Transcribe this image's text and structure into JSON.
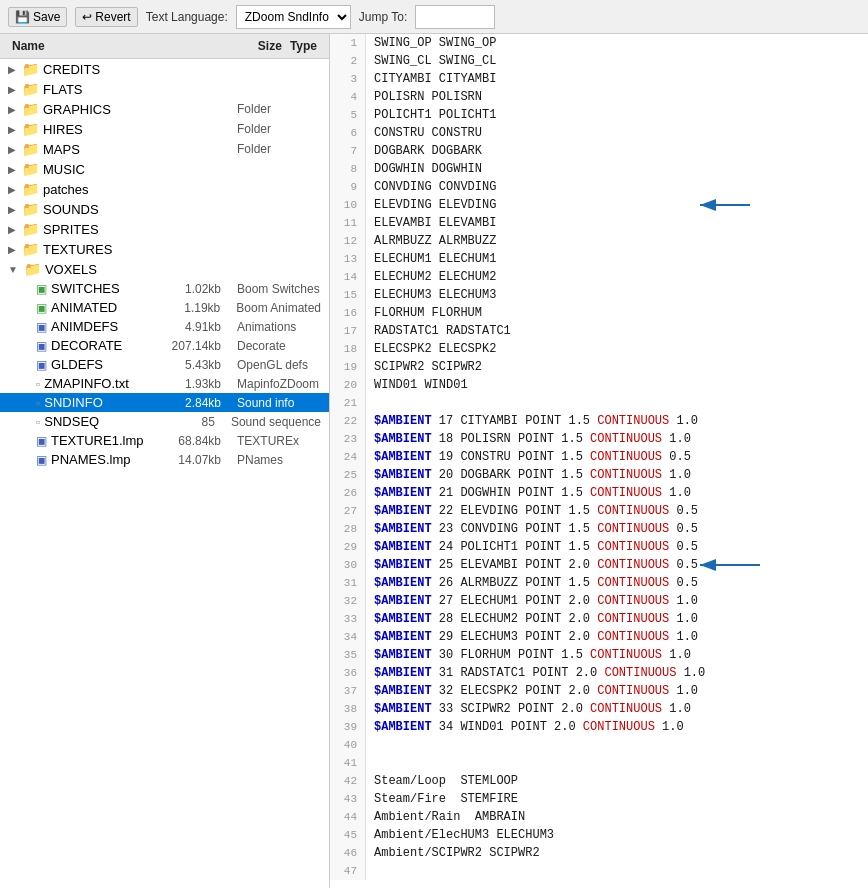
{
  "toolbar": {
    "save_label": "Save",
    "revert_label": "Revert",
    "text_language_label": "Text Language:",
    "text_language_value": "ZDoom SndInfo",
    "jump_to_label": "Jump To:",
    "jump_to_value": ""
  },
  "file_tree": {
    "headers": [
      "Name",
      "Size",
      "Type"
    ],
    "items": [
      {
        "id": "credits",
        "name": "CREDITS",
        "size": "",
        "type": "",
        "indent": 1,
        "icon": "folder",
        "expanded": false
      },
      {
        "id": "flats",
        "name": "FLATS",
        "size": "",
        "type": "",
        "indent": 1,
        "icon": "folder",
        "expanded": false
      },
      {
        "id": "graphics",
        "name": "GRAPHICS",
        "size": "",
        "type": "Folder",
        "indent": 1,
        "icon": "folder",
        "expanded": false
      },
      {
        "id": "hires",
        "name": "HIRES",
        "size": "",
        "type": "Folder",
        "indent": 1,
        "icon": "folder",
        "expanded": false
      },
      {
        "id": "maps",
        "name": "MAPS",
        "size": "",
        "type": "Folder",
        "indent": 1,
        "icon": "folder",
        "expanded": false
      },
      {
        "id": "music",
        "name": "MUSIC",
        "size": "",
        "type": "",
        "indent": 1,
        "icon": "folder",
        "expanded": false
      },
      {
        "id": "patches",
        "name": "patches",
        "size": "",
        "type": "",
        "indent": 1,
        "icon": "folder",
        "expanded": false
      },
      {
        "id": "sounds",
        "name": "SOUNDS",
        "size": "",
        "type": "",
        "indent": 1,
        "icon": "folder",
        "expanded": false
      },
      {
        "id": "sprites",
        "name": "SPRITES",
        "size": "",
        "type": "",
        "indent": 1,
        "icon": "folder",
        "expanded": false
      },
      {
        "id": "textures",
        "name": "TEXTURES",
        "size": "",
        "type": "",
        "indent": 1,
        "icon": "folder",
        "expanded": false
      },
      {
        "id": "voxels",
        "name": "VOXELS",
        "size": "",
        "type": "",
        "indent": 1,
        "icon": "folder",
        "expanded": true
      },
      {
        "id": "switches",
        "name": "SWITCHES",
        "size": "1.02kb",
        "type": "Boom Switches",
        "indent": 2,
        "icon": "file-green"
      },
      {
        "id": "animated",
        "name": "ANIMATED",
        "size": "1.19kb",
        "type": "Boom Animated",
        "indent": 2,
        "icon": "file-green"
      },
      {
        "id": "animdefs",
        "name": "ANIMDEFS",
        "size": "4.91kb",
        "type": "Animations",
        "indent": 2,
        "icon": "file-blue"
      },
      {
        "id": "decorate",
        "name": "DECORATE",
        "size": "207.14kb",
        "type": "Decorate",
        "indent": 2,
        "icon": "file-blue"
      },
      {
        "id": "gldefs",
        "name": "GLDEFS",
        "size": "5.43kb",
        "type": "OpenGL defs",
        "indent": 2,
        "icon": "file-blue"
      },
      {
        "id": "zmapinfo",
        "name": "ZMAPINFO.txt",
        "size": "1.93kb",
        "type": "MapinfoZDoom",
        "indent": 2,
        "icon": "file"
      },
      {
        "id": "sndinfo",
        "name": "SNDINFO",
        "size": "2.84kb",
        "type": "Sound info",
        "indent": 2,
        "icon": "file",
        "selected": true
      },
      {
        "id": "sndseq",
        "name": "SNDSEQ",
        "size": "85",
        "type": "Sound sequence",
        "indent": 2,
        "icon": "file"
      },
      {
        "id": "texture1",
        "name": "TEXTURE1.lmp",
        "size": "68.84kb",
        "type": "TEXTUREx",
        "indent": 2,
        "icon": "file-blue"
      },
      {
        "id": "pnames",
        "name": "PNAMES.lmp",
        "size": "14.07kb",
        "type": "PNames",
        "indent": 2,
        "icon": "file-blue"
      }
    ]
  },
  "code_lines": [
    {
      "num": 1,
      "text": "SWING_OP SWING_OP"
    },
    {
      "num": 2,
      "text": "SWING_CL SWING_CL"
    },
    {
      "num": 3,
      "text": "CITYAMBI CITYAMBI"
    },
    {
      "num": 4,
      "text": "POLISRN POLISRN"
    },
    {
      "num": 5,
      "text": "POLICHT1 POLICHT1"
    },
    {
      "num": 6,
      "text": "CONSTRU CONSTRU"
    },
    {
      "num": 7,
      "text": "DOGBARK DOGBARK"
    },
    {
      "num": 8,
      "text": "DOGWHIN DOGWHIN"
    },
    {
      "num": 9,
      "text": "CONVDING CONVDING"
    },
    {
      "num": 10,
      "text": "ELEVDING ELEVDING"
    },
    {
      "num": 11,
      "text": "ELEVAMBI ELEVAMBI"
    },
    {
      "num": 12,
      "text": "ALRMBUZZ ALRMBUZZ"
    },
    {
      "num": 13,
      "text": "ELECHUM1 ELECHUM1"
    },
    {
      "num": 14,
      "text": "ELECHUM2 ELECHUM2"
    },
    {
      "num": 15,
      "text": "ELECHUM3 ELECHUM3"
    },
    {
      "num": 16,
      "text": "FLORHUM FLORHUM"
    },
    {
      "num": 17,
      "text": "RADSTATC1 RADSTATC1"
    },
    {
      "num": 18,
      "text": "ELECSPK2 ELECSPK2"
    },
    {
      "num": 19,
      "text": "SCIPWR2 SCIPWR2"
    },
    {
      "num": 20,
      "text": "WIND01 WIND01"
    },
    {
      "num": 21,
      "text": ""
    },
    {
      "num": 22,
      "text": "$AMBIENT 17 CITYAMBI POINT 1.5 CONTINUOUS 1.0"
    },
    {
      "num": 23,
      "text": "$AMBIENT 18 POLISRN POINT 1.5 CONTINUOUS 1.0"
    },
    {
      "num": 24,
      "text": "$AMBIENT 19 CONSTRU POINT 1.5 CONTINUOUS 0.5"
    },
    {
      "num": 25,
      "text": "$AMBIENT 20 DOGBARK POINT 1.5 CONTINUOUS 1.0"
    },
    {
      "num": 26,
      "text": "$AMBIENT 21 DOGWHIN POINT 1.5 CONTINUOUS 1.0"
    },
    {
      "num": 27,
      "text": "$AMBIENT 22 ELEVDING POINT 1.5 CONTINUOUS 0.5"
    },
    {
      "num": 28,
      "text": "$AMBIENT 23 CONVDING POINT 1.5 CONTINUOUS 0.5"
    },
    {
      "num": 29,
      "text": "$AMBIENT 24 POLICHT1 POINT 1.5 CONTINUOUS 0.5"
    },
    {
      "num": 30,
      "text": "$AMBIENT 25 ELEVAMBI POINT 2.0 CONTINUOUS 0.5"
    },
    {
      "num": 31,
      "text": "$AMBIENT 26 ALRMBUZZ POINT 1.5 CONTINUOUS 0.5"
    },
    {
      "num": 32,
      "text": "$AMBIENT 27 ELECHUM1 POINT 2.0 CONTINUOUS 1.0"
    },
    {
      "num": 33,
      "text": "$AMBIENT 28 ELECHUM2 POINT 2.0 CONTINUOUS 1.0"
    },
    {
      "num": 34,
      "text": "$AMBIENT 29 ELECHUM3 POINT 2.0 CONTINUOUS 1.0"
    },
    {
      "num": 35,
      "text": "$AMBIENT 30 FLORHUM POINT 1.5 CONTINUOUS 1.0"
    },
    {
      "num": 36,
      "text": "$AMBIENT 31 RADSTATC1 POINT 2.0 CONTINUOUS 1.0"
    },
    {
      "num": 37,
      "text": "$AMBIENT 32 ELECSPK2 POINT 2.0 CONTINUOUS 1.0"
    },
    {
      "num": 38,
      "text": "$AMBIENT 33 SCIPWR2 POINT 2.0 CONTINUOUS 1.0"
    },
    {
      "num": 39,
      "text": "$AMBIENT 34 WIND01 POINT 2.0 CONTINUOUS 1.0"
    },
    {
      "num": 40,
      "text": ""
    },
    {
      "num": 41,
      "text": ""
    },
    {
      "num": 42,
      "text": "Steam/Loop  STEMLOOP"
    },
    {
      "num": 43,
      "text": "Steam/Fire  STEMFIRE"
    },
    {
      "num": 44,
      "text": "Ambient/Rain  AMBRAIN"
    },
    {
      "num": 45,
      "text": "Ambient/ElecHUM3 ELECHUM3"
    },
    {
      "num": 46,
      "text": "Ambient/SCIPWR2 SCIPWR2"
    },
    {
      "num": 47,
      "text": ""
    }
  ]
}
